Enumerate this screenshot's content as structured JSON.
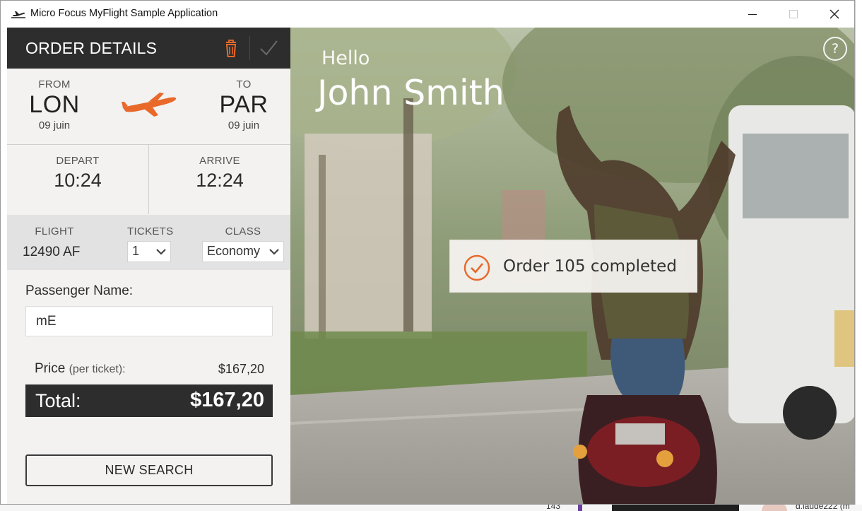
{
  "window": {
    "title": "Micro Focus MyFlight Sample Application",
    "close_glyph": "✕"
  },
  "order": {
    "header_title": "ORDER DETAILS",
    "from_label": "FROM",
    "from_city": "LON",
    "from_date": "09 juin",
    "to_label": "TO",
    "to_city": "PAR",
    "to_date": "09 juin",
    "depart_label": "DEPART",
    "depart_time": "10:24",
    "arrive_label": "ARRIVE",
    "arrive_time": "12:24",
    "flight_label": "FLIGHT",
    "flight_value": "12490 AF",
    "tickets_label": "TICKETS",
    "tickets_value": "1",
    "class_label": "CLASS",
    "class_value": "Economy",
    "passenger_label": "Passenger Name:",
    "passenger_value": "mE",
    "price_label": "Price",
    "price_sub": "(per ticket):",
    "price_value": "$167,20",
    "total_label": "Total:",
    "total_value": "$167,20",
    "new_search_label": "NEW SEARCH"
  },
  "greeting": {
    "hello": "Hello",
    "user_name": "John Smith",
    "help_glyph": "?"
  },
  "toast": {
    "message": "Order 105 completed"
  },
  "desktop": {
    "bottom_number": "143",
    "bottom_user": "d.laude222 (m"
  },
  "colors": {
    "accent": "#e8692a",
    "header_dark": "#2d2d2d",
    "panel_bg": "#f3f2f1"
  },
  "icons": {
    "app": "airplane-takeoff-icon",
    "delete": "trash-icon",
    "confirm": "checkmark-icon",
    "route": "airplane-icon",
    "toast": "check-circle-icon",
    "help": "help-icon"
  }
}
